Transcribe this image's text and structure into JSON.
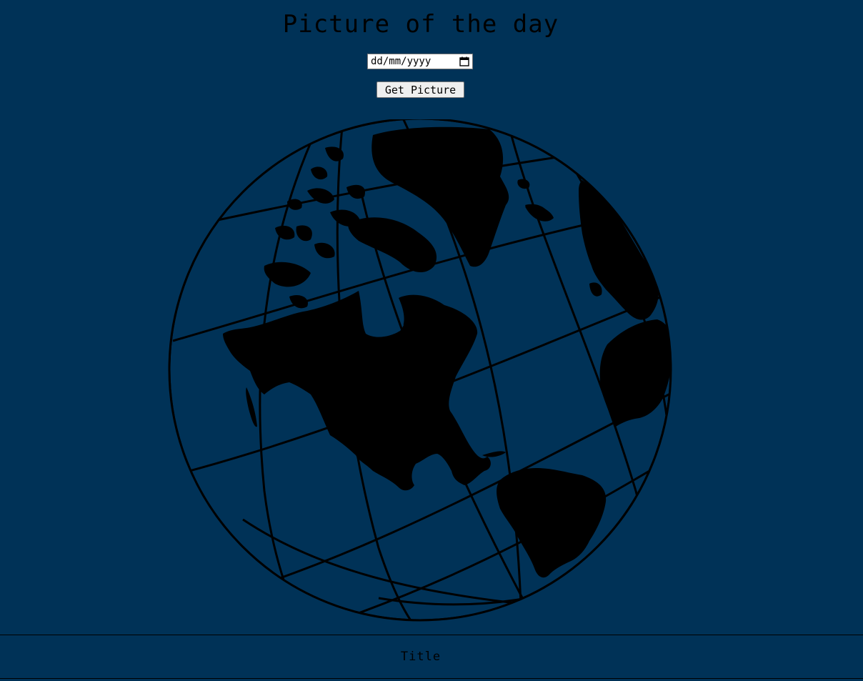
{
  "header": {
    "title": "Picture of the day"
  },
  "form": {
    "date_placeholder": "dd/mm/yyyy",
    "date_value": "",
    "submit_label": "Get Picture"
  },
  "image": {
    "icon": "globe-icon"
  },
  "footer": {
    "title": "Title"
  },
  "colors": {
    "background": "#003257",
    "foreground": "#000000"
  }
}
